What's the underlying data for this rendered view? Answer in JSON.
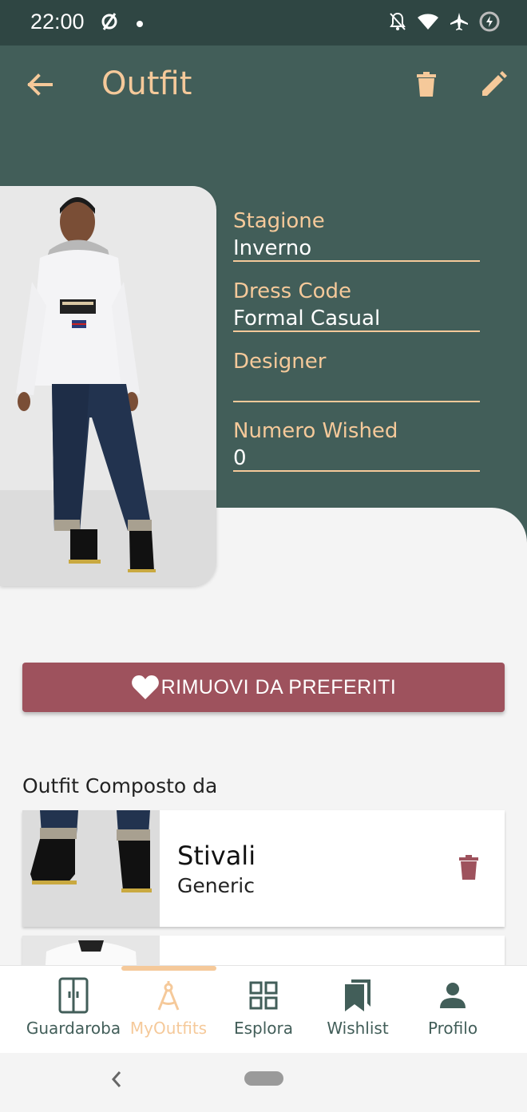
{
  "status_bar": {
    "time": "22:00"
  },
  "header": {
    "title": "Outfit"
  },
  "details": {
    "stagione": {
      "label": "Stagione",
      "value": "Inverno"
    },
    "dress_code": {
      "label": "Dress Code",
      "value": "Formal Casual"
    },
    "designer": {
      "label": "Designer",
      "value": ""
    },
    "numero_wished": {
      "label": "Numero Wished",
      "value": "0"
    }
  },
  "favorite_button": {
    "label": "RIMUOVI DA PREFERITI"
  },
  "composition": {
    "title": "Outfit Composto da",
    "items": [
      {
        "name": "Stivali",
        "brand": "Generic"
      },
      {
        "name": "",
        "brand": ""
      }
    ]
  },
  "bottom_nav": {
    "items": [
      {
        "label": "Guardaroba",
        "icon": "wardrobe-icon"
      },
      {
        "label": "MyOutfits",
        "icon": "compass-icon"
      },
      {
        "label": "Esplora",
        "icon": "grid-icon"
      },
      {
        "label": "Wishlist",
        "icon": "bookmarks-icon"
      },
      {
        "label": "Profilo",
        "icon": "person-icon"
      }
    ],
    "active_index": 1
  },
  "colors": {
    "header_bg": "#425e59",
    "accent": "#f5c99a",
    "favorite_button": "#9e525d",
    "status_bar": "#2f4643"
  }
}
